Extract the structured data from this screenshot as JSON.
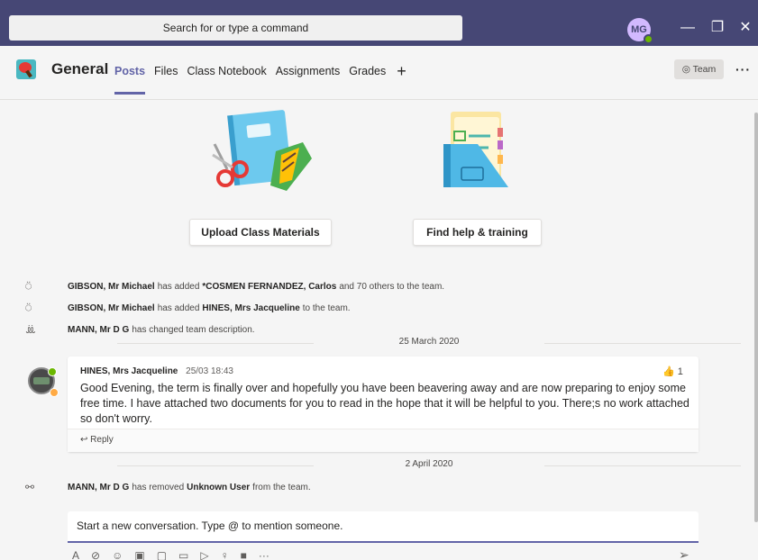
{
  "titlebar": {
    "search_placeholder": "Search for or type a command",
    "user_initials": "MG",
    "minimize_label": "—",
    "restore_label": "❐",
    "close_label": "✕"
  },
  "header": {
    "channel_name": "General",
    "tabs": [
      {
        "label": "Posts"
      },
      {
        "label": "Files"
      },
      {
        "label": "Class Notebook"
      },
      {
        "label": "Assignments"
      },
      {
        "label": "Grades"
      }
    ],
    "add_tab_label": "+",
    "team_button_label": "◎ Team",
    "more_label": "···"
  },
  "welcome": {
    "upload_button": "Upload Class Materials",
    "help_button": "Find help & training"
  },
  "activities": [
    {
      "actor": "GIBSON, Mr Michael",
      "text": "has added",
      "target": "*COSMEN FERNANDEZ, Carlos",
      "tail": "and 70 others to the team."
    },
    {
      "actor": "GIBSON, Mr Michael",
      "text": "has added",
      "target": "HINES, Mrs Jacqueline",
      "tail": "to the team."
    },
    {
      "actor": "MANN, Mr D G",
      "text": "has changed team description.",
      "target": "",
      "tail": ""
    }
  ],
  "date_separators": [
    "25 March 2020",
    "2 April 2020"
  ],
  "message": {
    "author": "HINES, Mrs Jacqueline",
    "time": "25/03 18:43",
    "like_count": "1",
    "body": "Good Evening, the term is finally over and hopefully you have been beavering away and are now preparing to enjoy some free time. I have attached two documents for you to read in the hope that it will be helpful to you. There;s no work attached so don't worry.",
    "reply_label": "Reply"
  },
  "removed_activity": {
    "actor": "MANN, Mr D G",
    "text": "has removed",
    "target": "Unknown User",
    "tail": "from the team."
  },
  "compose": {
    "placeholder": "Start a new conversation. Type @ to mention someone."
  },
  "icons": {
    "add_member": "person-add-icon",
    "description": "people-icon",
    "remove_member": "person-remove-icon"
  },
  "colors": {
    "titlebar": "#464775",
    "accent": "#6264a7",
    "presence_available": "#6bb700"
  }
}
